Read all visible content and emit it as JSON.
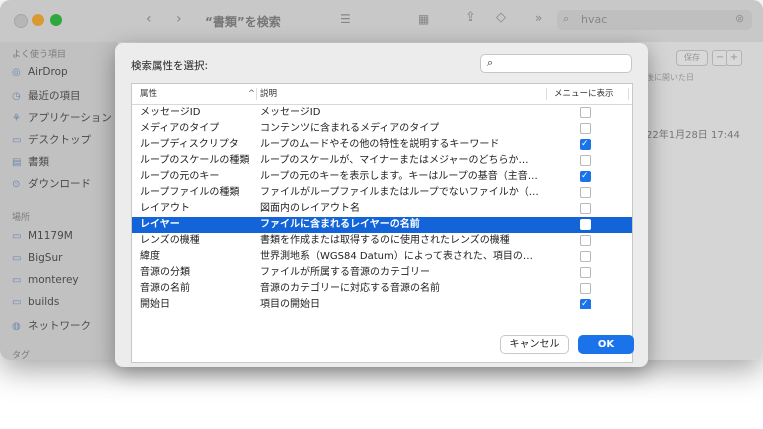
{
  "finder": {
    "title": "“書類”を検索",
    "search_value": "hvac",
    "sidebar": {
      "favorites_header": "よく使う項目",
      "favorites": [
        "AirDrop",
        "最近の項目",
        "アプリケーション",
        "デスクトップ",
        "書類",
        "ダウンロード"
      ],
      "locations_header": "場所",
      "locations": [
        "M1179M",
        "BigSur",
        "monterey",
        "builds",
        "ネットワーク"
      ],
      "tags_header": "タグ"
    },
    "save_label": "保存",
    "date_fragment": "22年1月28日 17:44",
    "column_fragment": "後に開いた日"
  },
  "sheet": {
    "prompt": "検索属性を選択:",
    "search_placeholder": "",
    "headers": {
      "attribute": "属性",
      "description": "説明",
      "in_menu": "メニューに表示"
    },
    "rows": [
      {
        "attr": "メッセージID",
        "desc": "メッセージID",
        "checked": false,
        "selected": false
      },
      {
        "attr": "メディアのタイプ",
        "desc": "コンテンツに含まれるメディアのタイプ",
        "checked": false,
        "selected": false
      },
      {
        "attr": "ループディスクリプタ",
        "desc": "ループのムードやその他の特性を説明するキーワード",
        "checked": true,
        "selected": false
      },
      {
        "attr": "ループのスケールの種類",
        "desc": "ループのスケールが、マイナーまたはメジャーのどちらか…",
        "checked": false,
        "selected": false
      },
      {
        "attr": "ループの元のキー",
        "desc": "ループの元のキーを表示します。キーはループの基音（主音…",
        "checked": true,
        "selected": false
      },
      {
        "attr": "ループファイルの種類",
        "desc": "ファイルがループファイルまたはループでないファイルか（…",
        "checked": false,
        "selected": false
      },
      {
        "attr": "レイアウト",
        "desc": "図面内のレイアウト名",
        "checked": false,
        "selected": false
      },
      {
        "attr": "レイヤー",
        "desc": "ファイルに含まれるレイヤーの名前",
        "checked": false,
        "selected": true
      },
      {
        "attr": "レンズの機種",
        "desc": "書類を作成または取得するのに使用されたレンズの機種",
        "checked": false,
        "selected": false
      },
      {
        "attr": "緯度",
        "desc": "世界測地系（WGS84 Datum）によって表された、項目の…",
        "checked": false,
        "selected": false
      },
      {
        "attr": "音源の分類",
        "desc": "ファイルが所属する音源のカテゴリー",
        "checked": false,
        "selected": false
      },
      {
        "attr": "音源の名前",
        "desc": "音源のカテゴリーに対応する音源の名前",
        "checked": false,
        "selected": false
      },
      {
        "attr": "開始日",
        "desc": "項目の開始日",
        "checked": true,
        "selected": false
      }
    ],
    "cancel_label": "キャンセル",
    "ok_label": "OK"
  },
  "colors": {
    "accent": "#1264d8",
    "checkbox_on": "#1a73e8",
    "ok_button": "#1a73e8"
  }
}
